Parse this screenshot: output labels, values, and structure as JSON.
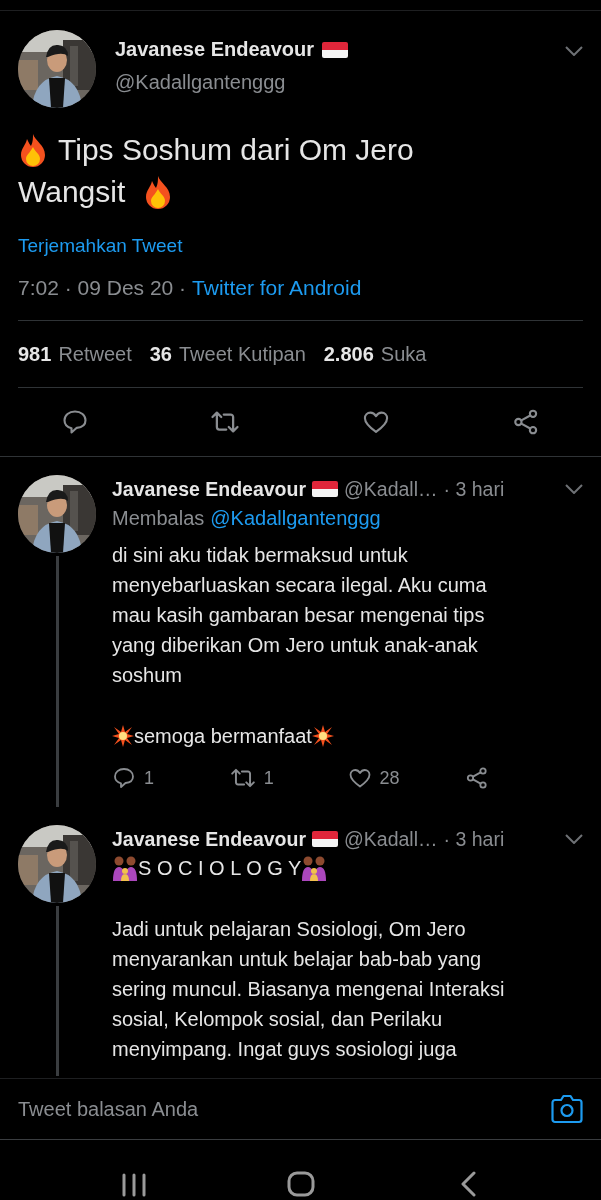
{
  "tweet": {
    "name": "Javanese Endeavour",
    "handle": "@Kadallgantenggg",
    "text_lines": [
      "Tips Soshum dari Om Jero",
      "Wangsit"
    ],
    "translate_link": "Terjemahkan Tweet",
    "timestamp": "7:02 · 09 Des 20 ·",
    "source": "Twitter for Android",
    "stats": [
      {
        "count": "981",
        "label": "Retweet"
      },
      {
        "count": "36",
        "label": "Tweet Kutipan"
      },
      {
        "count": "2.806",
        "label": "Suka"
      }
    ]
  },
  "replies": [
    {
      "name": "Javanese Endeavour",
      "handle": "@Kadall…",
      "time": "· 3 hari",
      "thread_line": true,
      "replying_label": "Membalas",
      "replying_to": "@Kadallgantenggg",
      "blocks": [
        {
          "kind": "text",
          "text": "di sini aku tidak bermaksud untuk\nmenyebarluaskan secara ilegal. Aku cuma\nmau kasih gambaran besar mengenai tips\nyang diberikan Om Jero untuk anak-anak\nsoshum"
        },
        {
          "kind": "burst",
          "text": "semoga bermanfaat"
        }
      ],
      "counts": {
        "replies": "1",
        "retweets": "1",
        "likes": "28"
      }
    },
    {
      "name": "Javanese Endeavour",
      "handle": "@Kadall…",
      "time": "· 3 hari",
      "thread_line": true,
      "blocks": [
        {
          "kind": "family",
          "text": "S O C I O L O G Y"
        },
        {
          "kind": "text",
          "text": "Jadi untuk pelajaran Sosiologi, Om Jero\nmenyarankan untuk belajar bab-bab yang\nsering muncul. Biasanya mengenai Interaksi\nsosial, Kelompok sosial, dan Perilaku\nmenyimpang. Ingat guys sosiologi juga"
        }
      ]
    }
  ],
  "reply_bar": {
    "placeholder": "Tweet balasan Anda"
  }
}
